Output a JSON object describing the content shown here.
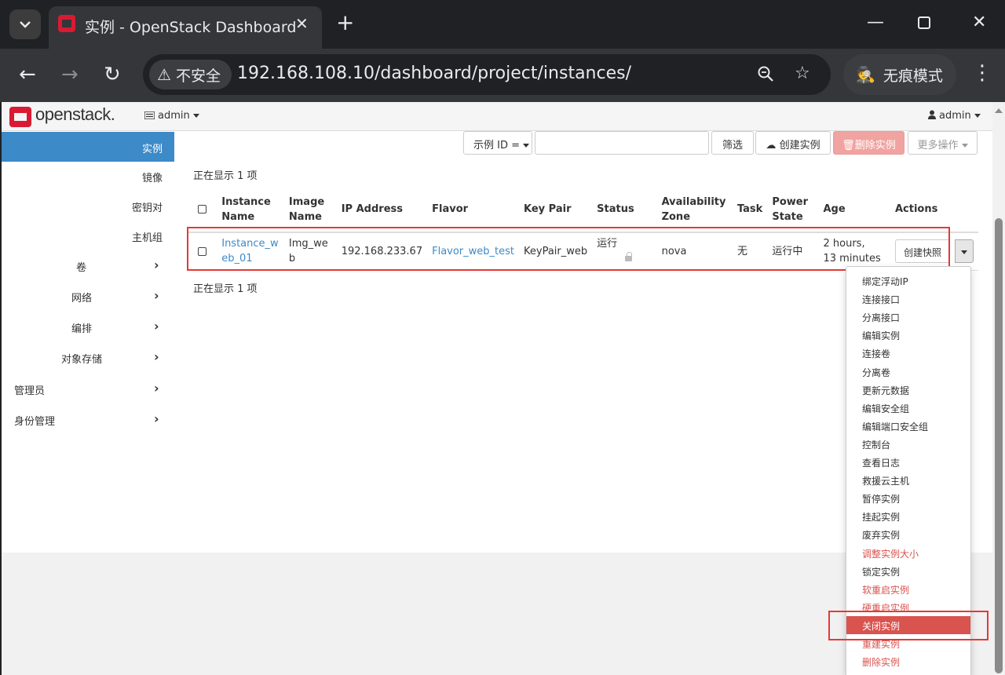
{
  "browser": {
    "tab_title": "实例 - OpenStack Dashboard",
    "security_label": "不安全",
    "url": "192.168.108.10/dashboard/project/instances/",
    "incognito_label": "无痕模式"
  },
  "header": {
    "logo_text": "openstack.",
    "project": "admin",
    "user": "admin"
  },
  "sidebar": {
    "items": [
      "实例",
      "镜像",
      "密钥对",
      "主机组",
      "卷",
      "网络",
      "编排",
      "对象存储",
      "管理员",
      "身份管理"
    ]
  },
  "toolbar": {
    "filter_select": "示例 ID =",
    "filter_value": "",
    "filter_button": "筛选",
    "create_button": "创建实例",
    "delete_button": "删除实例",
    "more_button": "更多操作"
  },
  "table": {
    "showing_top": "正在显示 1 项",
    "showing_bottom": "正在显示 1 项",
    "headers": {
      "instance_name": [
        "Instance",
        "Name"
      ],
      "image_name": [
        "Image",
        "Name"
      ],
      "ip": "IP Address",
      "flavor": "Flavor",
      "key_pair": "Key Pair",
      "status": "Status",
      "az": [
        "Availability",
        "Zone"
      ],
      "task": "Task",
      "power": [
        "Power",
        "State"
      ],
      "age": "Age",
      "actions": "Actions"
    },
    "row": {
      "instance_name": [
        "Instance_w",
        "eb_01"
      ],
      "image_name": [
        "Img_we",
        "b"
      ],
      "ip": "192.168.233.67",
      "flavor": "Flavor_web_test",
      "key_pair": "KeyPair_web",
      "status": "运行",
      "az": "nova",
      "task": "无",
      "power": "运行中",
      "age": [
        "2 hours,",
        "13 minutes"
      ],
      "action_button": "创建快照"
    }
  },
  "actions_menu": [
    {
      "label": "绑定浮动IP",
      "style": "normal"
    },
    {
      "label": "连接接口",
      "style": "normal"
    },
    {
      "label": "分离接口",
      "style": "normal"
    },
    {
      "label": "编辑实例",
      "style": "normal"
    },
    {
      "label": "连接卷",
      "style": "normal"
    },
    {
      "label": "分离卷",
      "style": "normal"
    },
    {
      "label": "更新元数据",
      "style": "normal"
    },
    {
      "label": "编辑安全组",
      "style": "normal"
    },
    {
      "label": "编辑端口安全组",
      "style": "normal"
    },
    {
      "label": "控制台",
      "style": "normal"
    },
    {
      "label": "查看日志",
      "style": "normal"
    },
    {
      "label": "救援云主机",
      "style": "normal"
    },
    {
      "label": "暂停实例",
      "style": "normal"
    },
    {
      "label": "挂起实例",
      "style": "normal"
    },
    {
      "label": "废弃实例",
      "style": "normal"
    },
    {
      "label": "调整实例大小",
      "style": "danger"
    },
    {
      "label": "锁定实例",
      "style": "normal"
    },
    {
      "label": "软重启实例",
      "style": "danger"
    },
    {
      "label": "硬重启实例",
      "style": "danger"
    },
    {
      "label": "关闭实例",
      "style": "highlight"
    },
    {
      "label": "重建实例",
      "style": "danger"
    },
    {
      "label": "删除实例",
      "style": "danger"
    }
  ],
  "colors": {
    "accent": "#3d8ac8",
    "danger": "#d9534f",
    "annotation": "#e53935"
  }
}
